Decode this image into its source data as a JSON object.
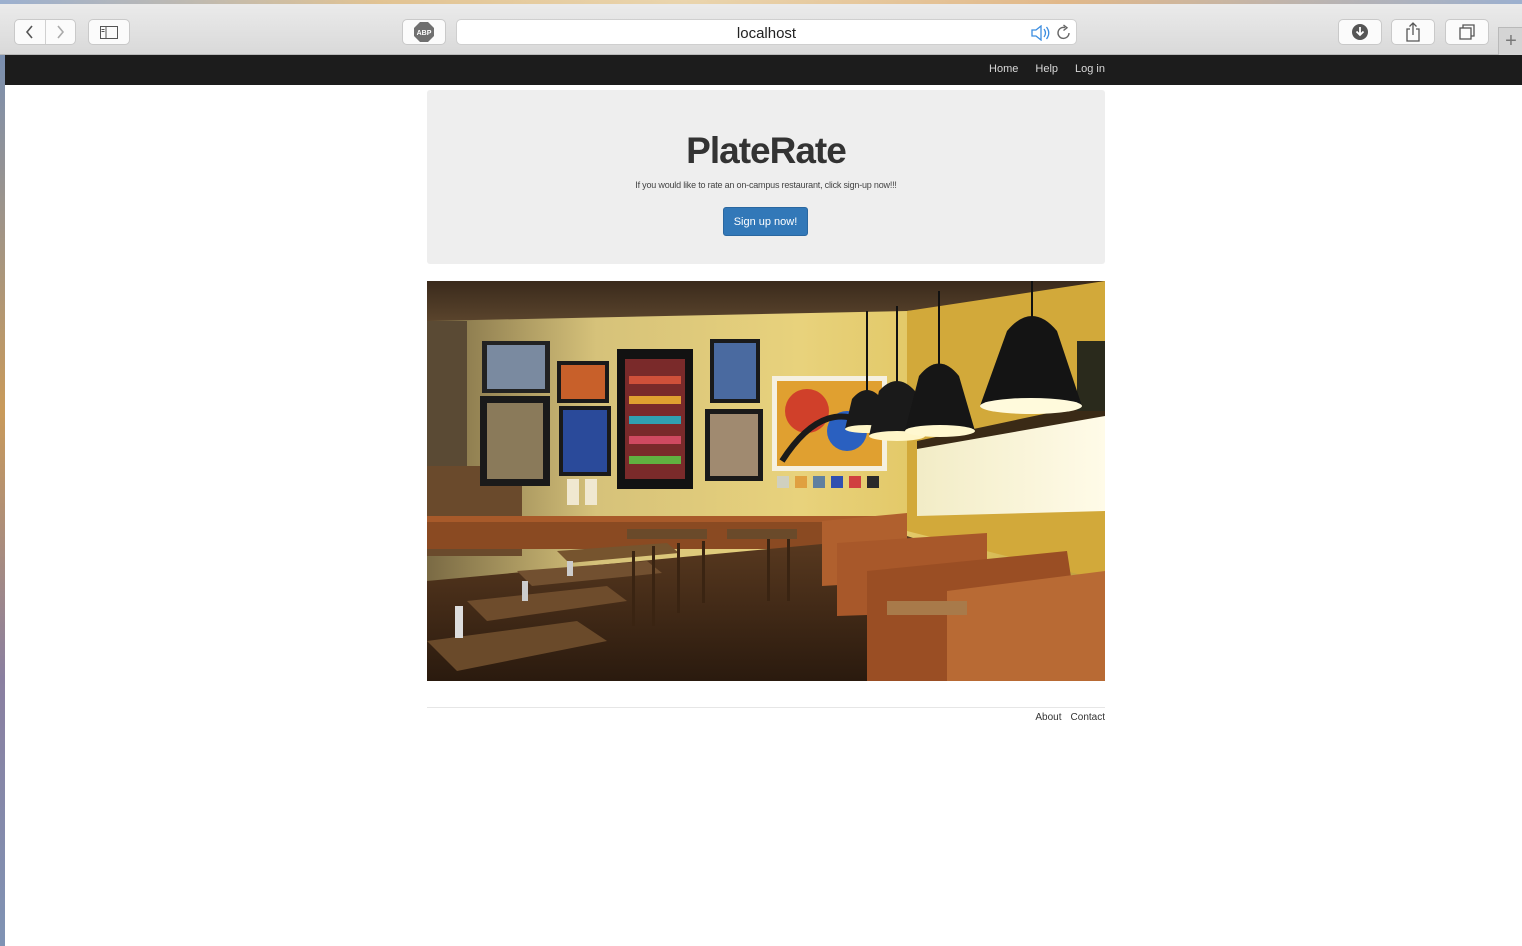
{
  "browser": {
    "address": "localhost",
    "adblock_badge": "ABP",
    "icons": [
      "back-icon",
      "forward-icon",
      "sidebar-icon",
      "adblock-icon",
      "speaker-icon",
      "reload-icon",
      "download-icon",
      "share-icon",
      "tabs-icon",
      "plus-icon"
    ]
  },
  "navbar": {
    "links": [
      "Home",
      "Help",
      "Log in"
    ]
  },
  "jumbotron": {
    "title": "PlateRate",
    "tagline": "If you would like to rate an on-campus restaurant, click sign-up now!!!",
    "button": "Sign up now!"
  },
  "footer": {
    "links": [
      "About",
      "Contact"
    ]
  },
  "colors": {
    "navbar_bg": "#1c1c1c",
    "jumbotron_bg": "#eeeeee",
    "button_primary": "#3278b8"
  }
}
